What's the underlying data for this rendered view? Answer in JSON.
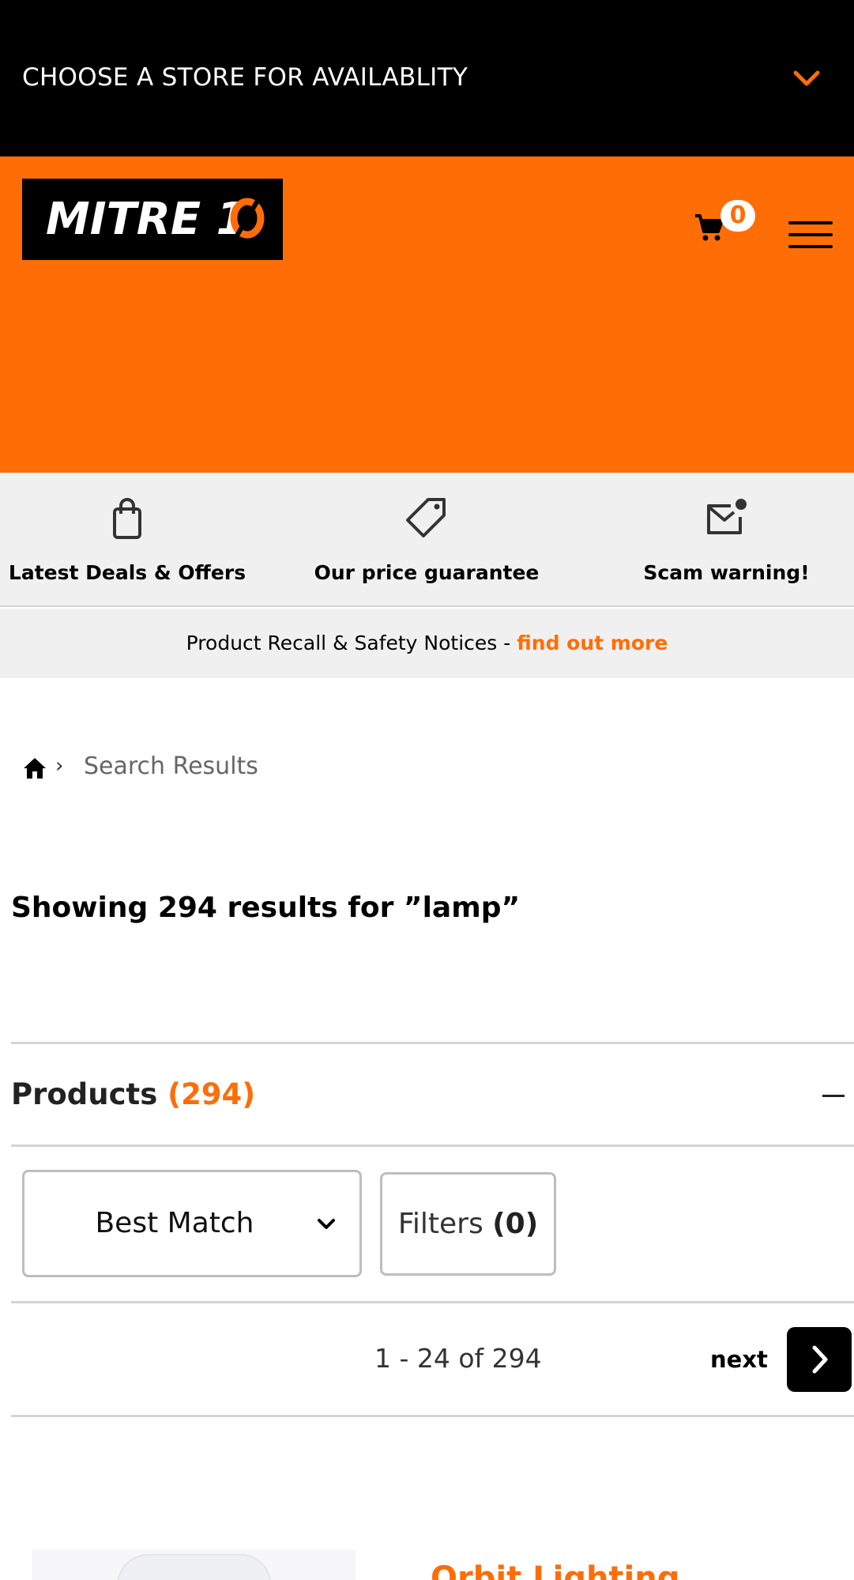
{
  "store_bar": {
    "label": "CHOOSE A STORE FOR AVAILABLITY",
    "icon": "chevron-down-icon"
  },
  "header": {
    "logo_text": "MITRE 10",
    "cart_count": "0",
    "colors": {
      "brand_orange": "#ff6d07",
      "black": "#000000"
    }
  },
  "search": {
    "value": "lamp",
    "placeholder": ""
  },
  "quick_links": [
    {
      "label": "Latest Deals & Offers",
      "icon": "shopping-bag-icon"
    },
    {
      "label": "Our price guarantee",
      "icon": "price-tag-icon"
    },
    {
      "label": "Scam warning!",
      "icon": "mail-alert-icon"
    }
  ],
  "recall": {
    "text": "Product Recall & Safety Notices - ",
    "link": "find out more"
  },
  "breadcrumb": {
    "separator": "›",
    "current": "Search Results"
  },
  "results": {
    "title": "Showing 294 results for ”lamp”"
  },
  "products": {
    "label": "Products",
    "count": "(294)"
  },
  "sort": {
    "selected": "Best Match"
  },
  "filters": {
    "label": "Filters",
    "count": "(0)"
  },
  "pagination": {
    "range": "1 - 24 of 294",
    "next_label": "next"
  },
  "product_preview": {
    "brand": "Orbit Lighting"
  }
}
